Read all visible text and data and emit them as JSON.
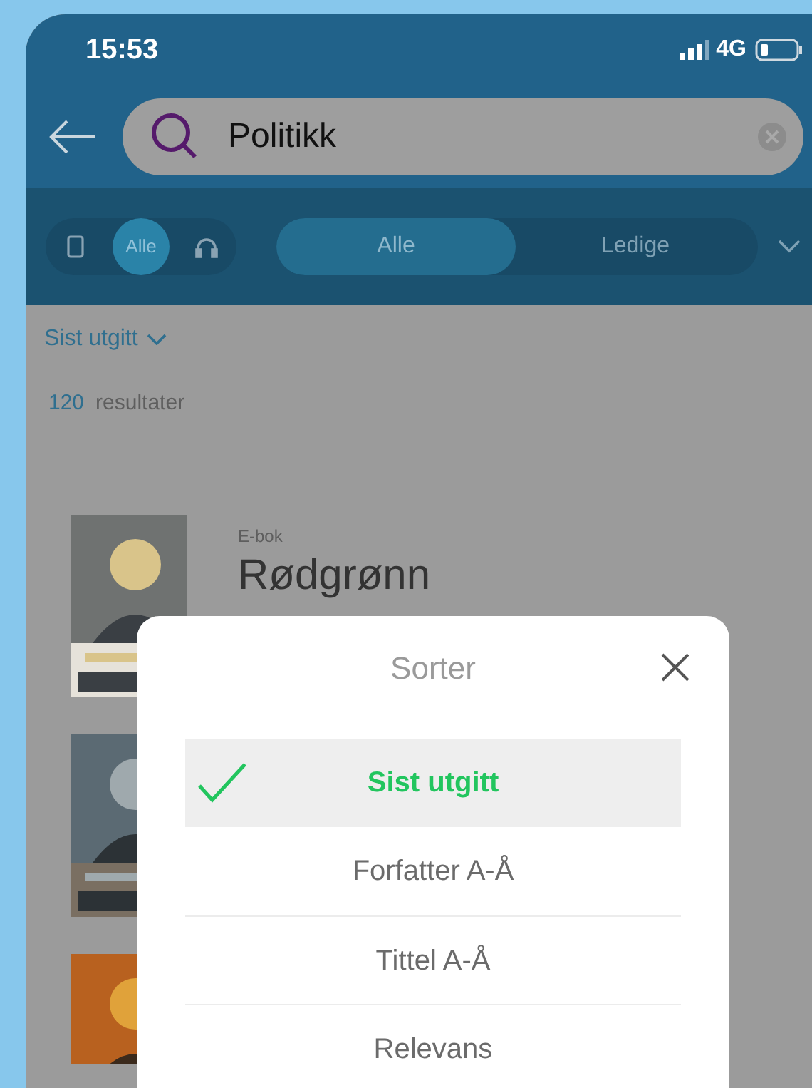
{
  "status_bar": {
    "time": "15:53",
    "network": "4G"
  },
  "search": {
    "value": "Politikk"
  },
  "format_filter": {
    "items": [
      {
        "kind": "ebook",
        "selected": false
      },
      {
        "kind": "all",
        "label": "Alle",
        "selected": true
      },
      {
        "kind": "audio",
        "selected": false
      }
    ]
  },
  "availability_tabs": [
    {
      "label": "Alle",
      "selected": true
    },
    {
      "label": "Ledige",
      "selected": false
    }
  ],
  "sort_link": "Sist utgitt",
  "result_count": {
    "number": "120",
    "label": "resultater"
  },
  "books": [
    {
      "kind": "picture",
      "format": "E-bok",
      "title": "Rødgrønn"
    },
    {
      "kind": "picture"
    },
    {
      "kind": "picture"
    }
  ],
  "sort_dialog": {
    "title": "Sorter",
    "options": [
      {
        "label": "Sist utgitt",
        "selected": true
      },
      {
        "label": "Forfatter A-Å",
        "selected": false
      },
      {
        "label": "Tittel A-Å",
        "selected": false
      },
      {
        "label": "Relevans",
        "selected": false
      }
    ]
  }
}
